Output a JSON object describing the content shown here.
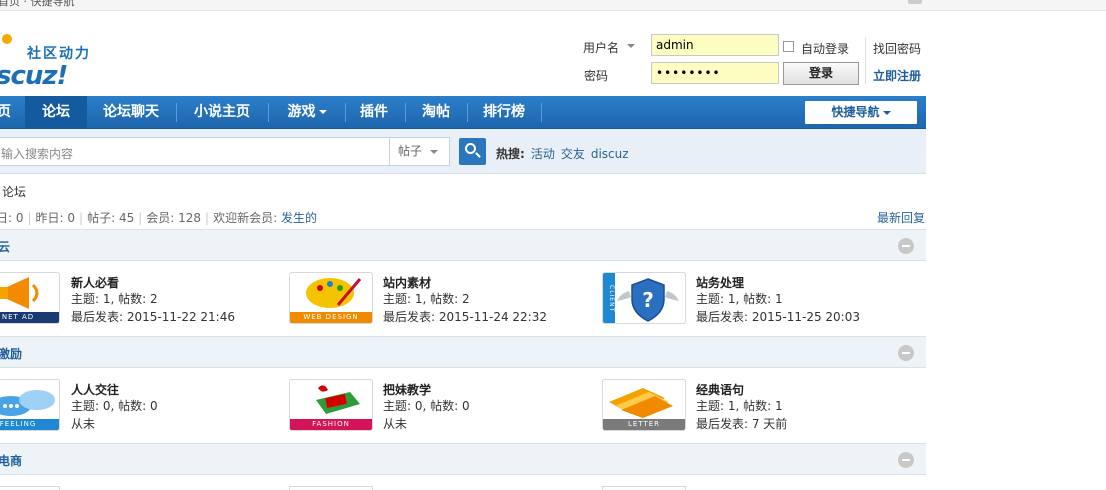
{
  "topbar": {
    "text": "首页 · 快捷导航"
  },
  "logo": {
    "sub": "社区动力",
    "main": "scuz!"
  },
  "login": {
    "username_label": "用户名",
    "username_value": "admin",
    "password_label": "密码",
    "password_value": "••••••••",
    "auto_login_label": "自动登录",
    "login_button": "登录",
    "forgot_password": "找回密码",
    "register": "立即注册"
  },
  "nav": {
    "items": [
      {
        "label": "页"
      },
      {
        "label": "论坛"
      },
      {
        "label": "论坛聊天"
      },
      {
        "label": "小说主页"
      },
      {
        "label": "游戏"
      },
      {
        "label": "插件"
      },
      {
        "label": "淘帖"
      },
      {
        "label": "排行榜"
      }
    ],
    "quick_nav": "快捷导航"
  },
  "search": {
    "placeholder": "输入搜索内容",
    "type": "帖子",
    "hot_label": "热搜:",
    "hot_items": [
      "活动",
      "交友",
      "discuz"
    ]
  },
  "breadcrumb": "论坛",
  "stats": {
    "today": "日: 0",
    "yesterday": "昨日: 0",
    "posts": "帖子: 45",
    "members": "会员: 128",
    "welcome": "欢迎新会员:",
    "new_member": "发生的",
    "latest": "最新回复"
  },
  "categories": [
    {
      "title": "云",
      "forums": [
        {
          "name": "新人必看",
          "topics": "主题: 1, 帖数: 2",
          "last": "最后发表: 2015-11-22 21:46",
          "icon": "megaphone-icon",
          "band": "NET AD",
          "band_color": "#1a3a73"
        },
        {
          "name": "站内素材",
          "topics": "主题: 1, 帖数: 2",
          "last": "最后发表: 2015-11-24 22:32",
          "icon": "palette-icon",
          "band": "WEB DESIGN",
          "band_color": "#f08b00"
        },
        {
          "name": "站务处理",
          "topics": "主题: 1, 帖数: 1",
          "last": "最后发表: 2015-11-25 20:03",
          "icon": "shield-question-icon",
          "band": "CLIENT",
          "band_color": "#1e88d2"
        }
      ]
    },
    {
      "title": "激励",
      "forums": [
        {
          "name": "人人交往",
          "topics": "主题: 0, 帖数: 0",
          "last": "从未",
          "icon": "cloud-chat-icon",
          "band": "FEELING",
          "band_color": "#1e88d2"
        },
        {
          "name": "把妹教学",
          "topics": "主题: 0, 帖数: 0",
          "last": "从未",
          "icon": "gift-box-icon",
          "band": "FASHION",
          "band_color": "#d4145a"
        },
        {
          "name": "经典语句",
          "topics": "主题: 1, 帖数: 1",
          "last": "最后发表: 7 天前",
          "icon": "letter-icon",
          "band": "LETTER",
          "band_color": "#7a7a7a"
        }
      ]
    },
    {
      "title": "电商",
      "forums": []
    }
  ]
}
